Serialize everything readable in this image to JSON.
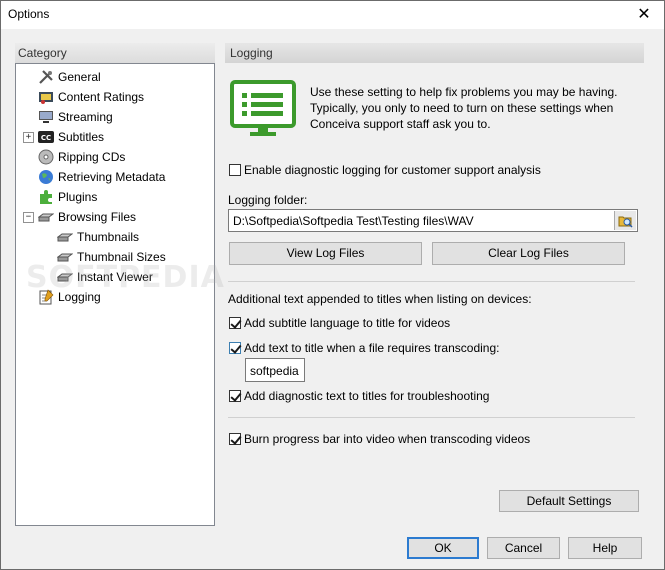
{
  "window": {
    "title": "Options"
  },
  "category": {
    "header": "Category",
    "items": [
      {
        "label": "General",
        "icon": "tools-icon"
      },
      {
        "label": "Content Ratings",
        "icon": "ratings-icon"
      },
      {
        "label": "Streaming",
        "icon": "streaming-icon"
      },
      {
        "label": "Subtitles",
        "icon": "cc-icon"
      },
      {
        "label": "Ripping CDs",
        "icon": "cd-icon"
      },
      {
        "label": "Retrieving Metadata",
        "icon": "globe-icon"
      },
      {
        "label": "Plugins",
        "icon": "puzzle-icon"
      },
      {
        "label": "Browsing Files",
        "icon": "drive-icon"
      },
      {
        "label": "Thumbnails",
        "icon": "drive-icon"
      },
      {
        "label": "Thumbnail Sizes",
        "icon": "drive-icon"
      },
      {
        "label": "Instant Viewer",
        "icon": "drive-icon"
      },
      {
        "label": "Logging",
        "icon": "logging-icon"
      }
    ]
  },
  "logging": {
    "header": "Logging",
    "intro": "Use these setting to help fix problems you may be having.  Typically, you only to need to turn on these settings when Conceiva support staff ask you to.",
    "enable_label": "Enable diagnostic logging for customer support analysis",
    "enable_checked": false,
    "folder_label": "Logging folder:",
    "folder_value": "D:\\Softpedia\\Softpedia Test\\Testing files\\WAV",
    "view_btn": "View Log Files",
    "clear_btn": "Clear Log Files",
    "additional_label": "Additional text appended to titles when listing on devices:",
    "opt_subtitle": "Add subtitle language to title for videos",
    "opt_transcode": "Add text to title when a file requires transcoding:",
    "transcode_text": "softpedia",
    "opt_diag": "Add diagnostic text to titles for troubleshooting",
    "opt_burn": "Burn progress bar into video when transcoding videos",
    "default_btn": "Default Settings"
  },
  "footer": {
    "ok": "OK",
    "cancel": "Cancel",
    "help": "Help"
  },
  "watermark": "SOFTPEDIA",
  "colors": {
    "accent": "#3c9a2c",
    "focus": "#2c7bd0"
  }
}
